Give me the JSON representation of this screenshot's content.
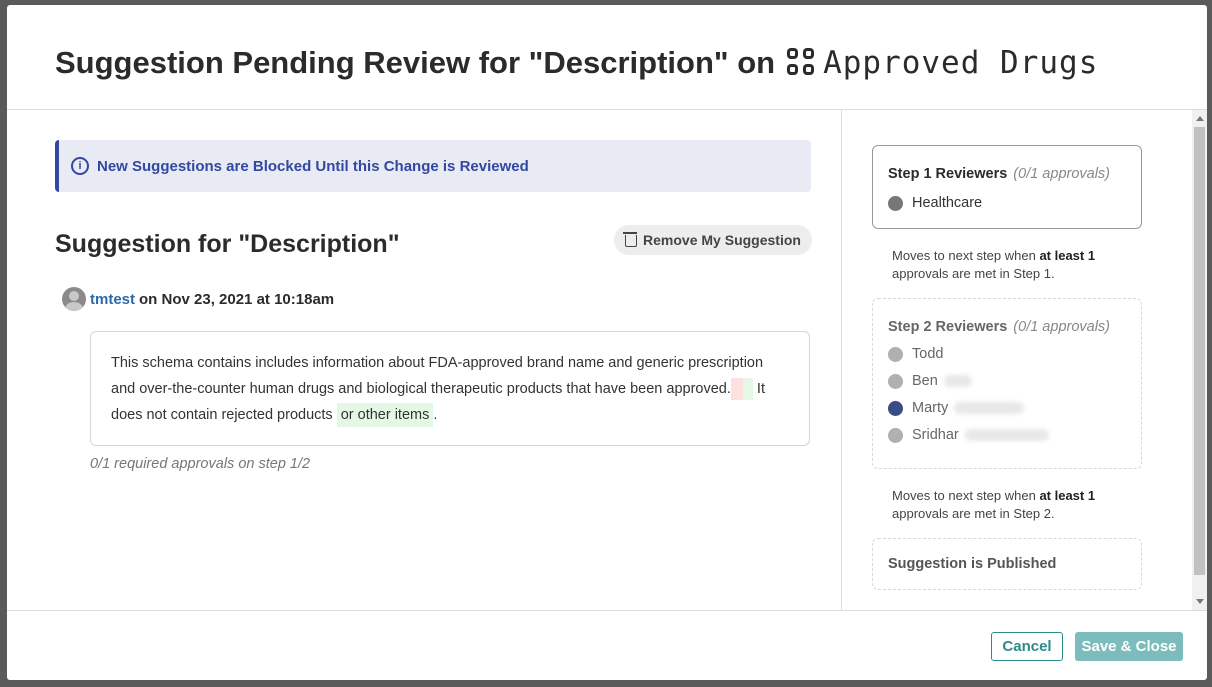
{
  "modal": {
    "title_prefix": "Suggestion Pending Review for \"Description\" on",
    "title_asset": "Approved Drugs",
    "asset_icon": "grid-icon"
  },
  "banner": {
    "icon": "info-icon",
    "icon_glyph": "i",
    "text": "New Suggestions are Blocked Until this Change is Reviewed"
  },
  "suggestion": {
    "heading": "Suggestion for \"Description\"",
    "remove_label": "Remove My Suggestion",
    "author": "tmtest",
    "date_text": "on Nov 23, 2021 at 10:18am",
    "text_part1": "This schema contains includes information about FDA-approved brand name and generic prescription and over-the-counter human drugs and biological therapeutic products that have been approved.",
    "text_part2": "It does not contain rejected products",
    "inserted_text": "or other items",
    "text_end": ".",
    "approvals_note": "0/1 required approvals on step 1/2"
  },
  "steps": {
    "step1": {
      "title": "Step 1 Reviewers",
      "count": "(0/1 approvals)",
      "reviewers": [
        "Healthcare"
      ]
    },
    "note1": {
      "prefix": "Moves to next step when",
      "bold": "at least 1",
      "suffix": "approvals are met in Step 1."
    },
    "step2": {
      "title": "Step 2 Reviewers",
      "count": "(0/1 approvals)",
      "reviewers": [
        "Todd",
        "Ben",
        "Marty",
        "Sridhar"
      ]
    },
    "note2": {
      "prefix": "Moves to next step when",
      "bold": "at least 1",
      "suffix": "approvals are met in Step 2."
    },
    "published": "Suggestion is Published"
  },
  "footer": {
    "cancel": "Cancel",
    "save": "Save & Close"
  },
  "colors": {
    "accent_blue": "#3348a0",
    "link": "#2e6aa8",
    "teal": "#2e8a8a",
    "teal_disabled": "#7cbcbc",
    "insert_bg": "#e4f8e6",
    "delete_bg": "#fde0e0"
  }
}
